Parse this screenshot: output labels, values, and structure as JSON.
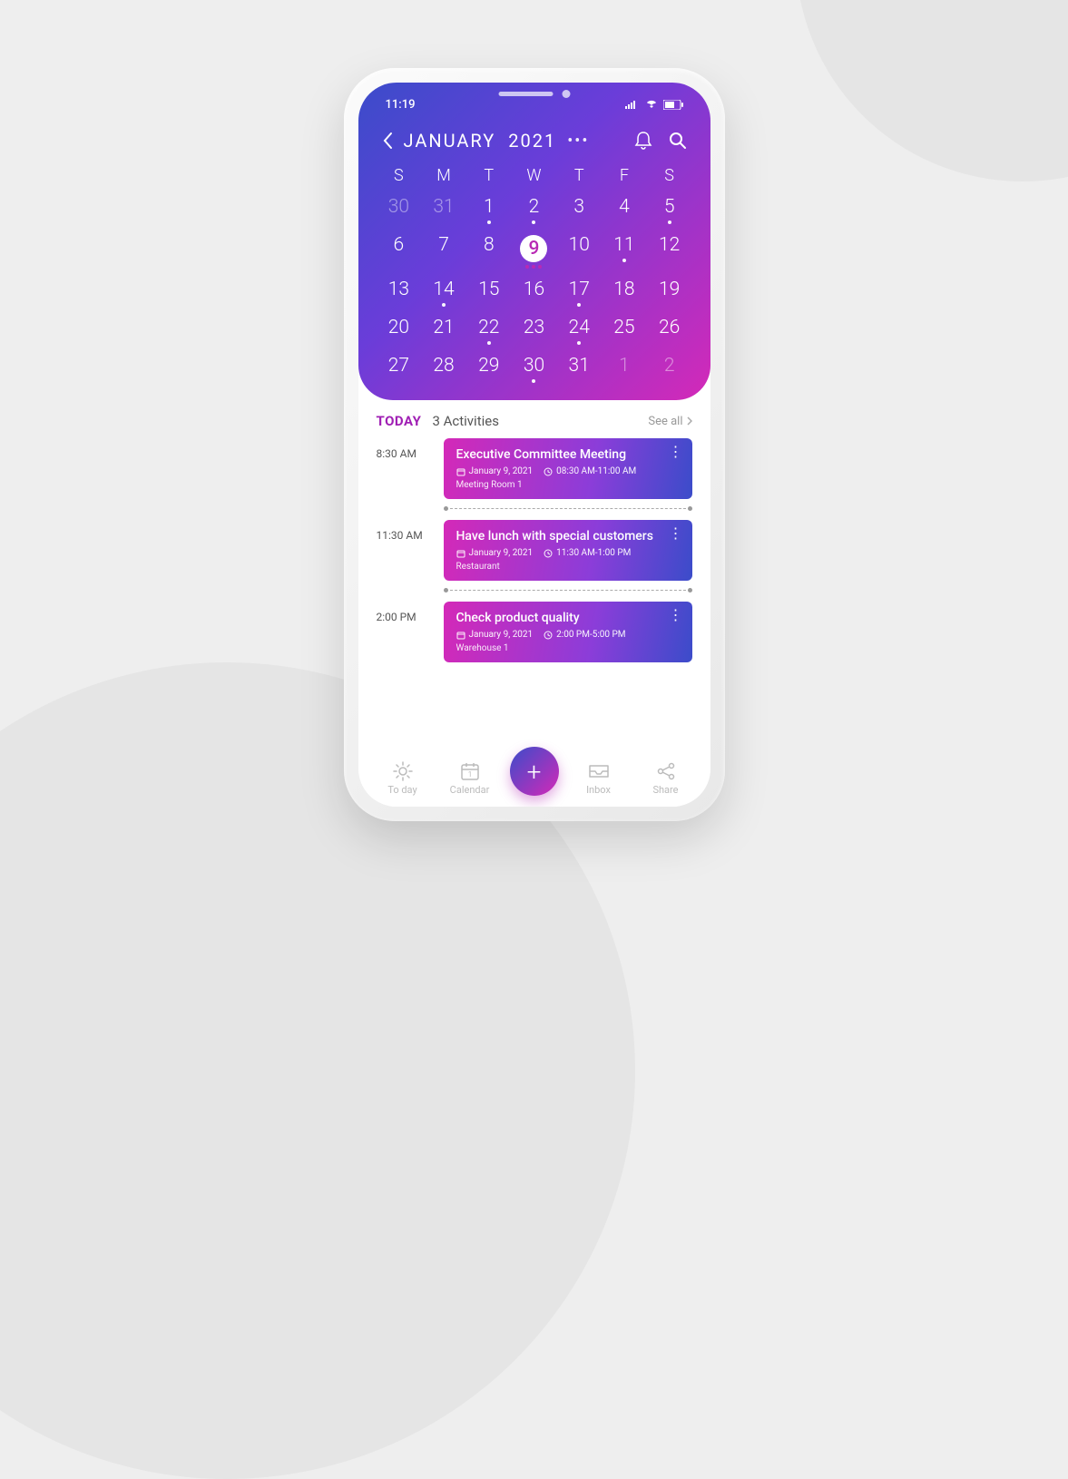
{
  "status": {
    "time": "11:19"
  },
  "header": {
    "month": "JANUARY",
    "year": "2021"
  },
  "weekdays": [
    "S",
    "M",
    "T",
    "W",
    "T",
    "F",
    "S"
  ],
  "calendar": [
    [
      {
        "n": "30",
        "muted": true,
        "dots": 0
      },
      {
        "n": "31",
        "muted": true,
        "dots": 0
      },
      {
        "n": "1",
        "dots": 1
      },
      {
        "n": "2",
        "dots": 1
      },
      {
        "n": "3",
        "dots": 0
      },
      {
        "n": "4",
        "dots": 0
      },
      {
        "n": "5",
        "dots": 1
      }
    ],
    [
      {
        "n": "6",
        "dots": 0
      },
      {
        "n": "7",
        "dots": 0
      },
      {
        "n": "8",
        "dots": 0
      },
      {
        "n": "9",
        "dots": 3,
        "selected": true
      },
      {
        "n": "10",
        "dots": 0
      },
      {
        "n": "11",
        "dots": 1
      },
      {
        "n": "12",
        "dots": 0
      }
    ],
    [
      {
        "n": "13",
        "dots": 0
      },
      {
        "n": "14",
        "dots": 1
      },
      {
        "n": "15",
        "dots": 0
      },
      {
        "n": "16",
        "dots": 0
      },
      {
        "n": "17",
        "dots": 1
      },
      {
        "n": "18",
        "dots": 0
      },
      {
        "n": "19",
        "dots": 0
      }
    ],
    [
      {
        "n": "20",
        "dots": 0
      },
      {
        "n": "21",
        "dots": 0
      },
      {
        "n": "22",
        "dots": 1
      },
      {
        "n": "23",
        "dots": 0
      },
      {
        "n": "24",
        "dots": 1
      },
      {
        "n": "25",
        "dots": 0
      },
      {
        "n": "26",
        "dots": 0
      }
    ],
    [
      {
        "n": "27",
        "dots": 0
      },
      {
        "n": "28",
        "dots": 0
      },
      {
        "n": "29",
        "dots": 0
      },
      {
        "n": "30",
        "dots": 1
      },
      {
        "n": "31",
        "dots": 0
      },
      {
        "n": "1",
        "muted": true,
        "dots": 0
      },
      {
        "n": "2",
        "muted": true,
        "dots": 0
      }
    ]
  ],
  "section": {
    "today_label": "TODAY",
    "count_text": "3 Activities",
    "see_all": "See all"
  },
  "activities": [
    {
      "time": "8:30 AM",
      "title": "Executive Committee Meeting",
      "date": "January 9, 2021",
      "range": "08:30 AM-11:00 AM",
      "location": "Meeting Room 1"
    },
    {
      "time": "11:30 AM",
      "title": "Have lunch with special customers",
      "date": "January 9, 2021",
      "range": "11:30 AM-1:00 PM",
      "location": "Restaurant"
    },
    {
      "time": "2:00 PM",
      "title": "Check product quality",
      "date": "January 9, 2021",
      "range": "2:00 PM-5:00 PM",
      "location": "Warehouse 1"
    }
  ],
  "nav": {
    "today": "To day",
    "calendar": "Calendar",
    "calendar_day": "1",
    "inbox": "Inbox",
    "share": "Share"
  }
}
